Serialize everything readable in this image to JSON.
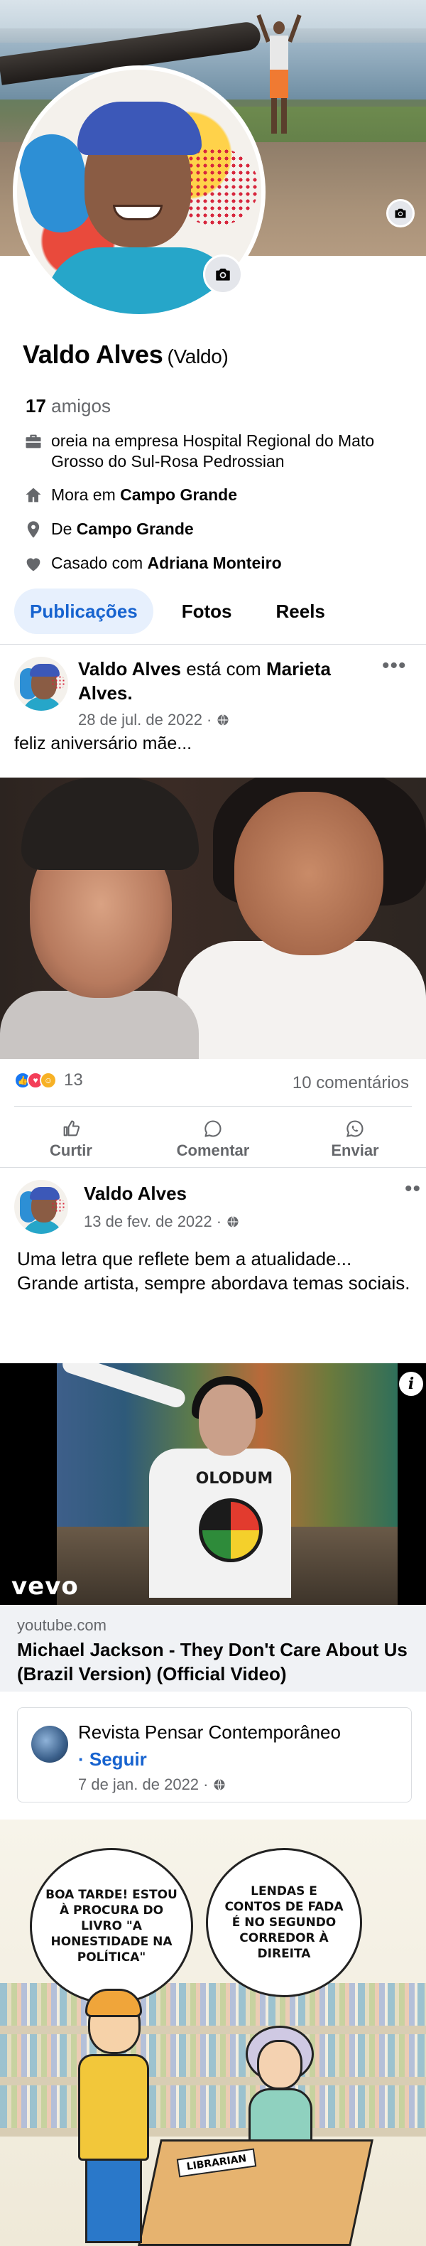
{
  "profile": {
    "name": "Valdo Alves",
    "nickname": "(Valdo)",
    "friends_count": "17",
    "friends_label": "amigos",
    "work": "oreia na empresa Hospital Regional do Mato Grosso do Sul-Rosa Pedrossian",
    "lives_prefix": "Mora em",
    "lives_city": "Campo Grande",
    "from_prefix": "De",
    "from_city": "Campo Grande",
    "relationship_prefix": "Casado com",
    "relationship_partner": "Adriana Monteiro"
  },
  "tabs": [
    "Publicações",
    "Fotos",
    "Reels"
  ],
  "post1": {
    "author": "Valdo Alves",
    "connector": "está com",
    "tagged": "Marieta Alves.",
    "date": "28 de jul. de 2022 ·",
    "text": "feliz aniversário mãe...",
    "reactions_count": "13",
    "comments": "10 comentários"
  },
  "actions": {
    "like": "Curtir",
    "comment": "Comentar",
    "share": "Enviar"
  },
  "post2": {
    "author": "Valdo Alves",
    "date": "13 de fev. de 2022 ·",
    "text": "Uma letra que reflete bem a atualidade... Grande artista, sempre abordava temas sociais.",
    "video_brand": "vevo",
    "video_shirt_text": "OLODUM",
    "link_domain": "youtube.com",
    "link_title": "Michael Jackson - They Don't Care About Us (Brazil Version) (Official Video)"
  },
  "shared": {
    "page_name": "Revista Pensar Contemporâneo",
    "follow": "· Seguir",
    "date": "7 de jan. de 2022 ·",
    "bubble_left": "BOA TARDE! ESTOU À PROCURA DO LIVRO \"A HONESTIDADE NA POLÍTICA\"",
    "bubble_right": "LENDAS E CONTOS DE FADA É NO SEGUNDO CORREDOR À DIREITA",
    "desk_sign": "LIBRARIAN"
  },
  "colors": {
    "accent": "#1763cf",
    "tab_active_bg": "#e7f0fd",
    "secondary_text": "#65676b"
  },
  "icons": {
    "camera": "camera-icon",
    "briefcase": "briefcase-icon",
    "home": "home-icon",
    "location": "location-pin-icon",
    "heart": "heart-icon",
    "globe": "globe-icon",
    "like": "thumbs-up-icon",
    "comment": "comment-bubble-icon",
    "share": "whatsapp-icon"
  }
}
